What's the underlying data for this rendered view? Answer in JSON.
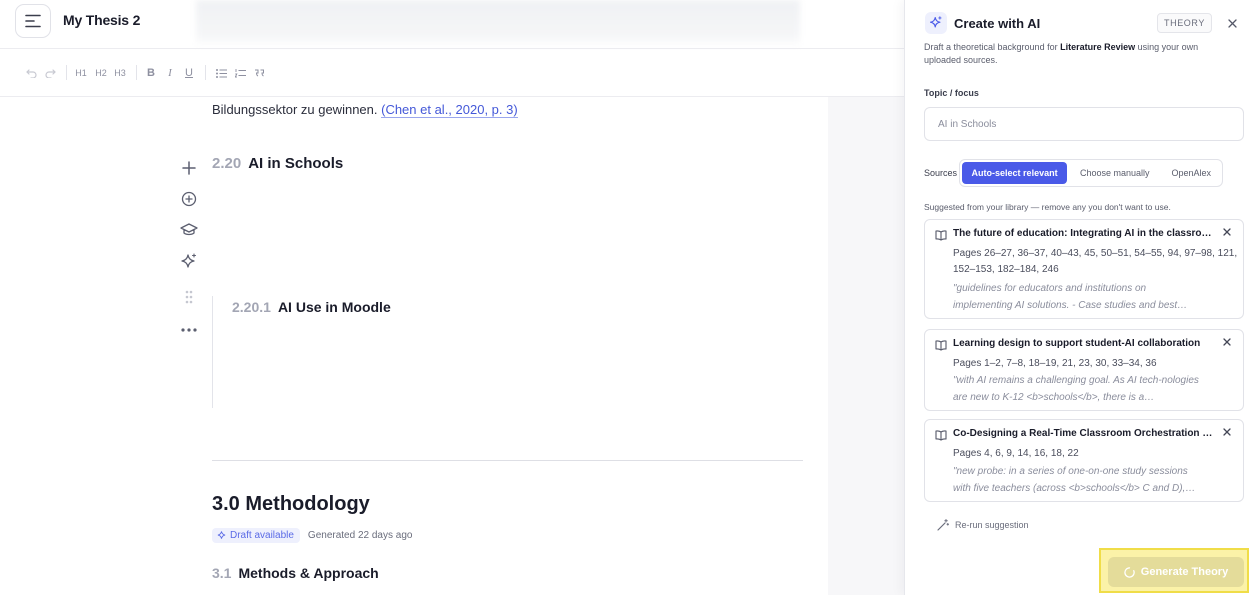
{
  "app": {
    "doc_title": "My Thesis 2"
  },
  "toolbar": {
    "h1": "H1",
    "h2": "H2",
    "h3": "H3",
    "bold": "B",
    "italic": "I",
    "underline": "U"
  },
  "document": {
    "paragraph_text": "Bildungssektor zu gewinnen. ",
    "paragraph_citation": "(Chen et al., 2020, p. 3)",
    "section_220": {
      "number": "2.20",
      "title": "AI in Schools"
    },
    "section_2201": {
      "number": "2.20.1",
      "title": "AI Use in Moodle"
    },
    "section_30": {
      "number": "3.0",
      "title": "Methodology"
    },
    "draft_badge": "Draft available",
    "generated_ago": "Generated 22 days ago",
    "section_31": {
      "number": "3.1",
      "title": "Methods & Approach"
    }
  },
  "panel": {
    "title": "Create with AI",
    "tag": "THEORY",
    "description_prefix": "Draft a theoretical background for ",
    "description_bold": "Literature Review",
    "description_suffix": " using your own uploaded sources.",
    "topic_label": "Topic / focus",
    "topic_value": "AI in Schools",
    "sources_label": "Sources",
    "source_options": [
      "Auto-select relevant",
      "Choose manually",
      "OpenAlex"
    ],
    "suggest_text": "Suggested from your library — remove any you don't want to use.",
    "cards": [
      {
        "title": "The future of education: Integrating AI in the classroom",
        "pages": "Pages 26–27, 36–37, 40–43, 45, 50–51, 54–55, 94, 97–98, 121, 152–153, 182–184, 246",
        "quote": "\"guidelines for educators and institutions on implementing AI solutions. - Case studies and best…"
      },
      {
        "title": "Learning design to support student-AI collaboration",
        "pages": "Pages 1–2, 7–8, 18–19, 21, 23, 30, 33–34, 36",
        "quote": "\"with AI remains a challenging goal. As AI tech-nologies are new to K-12 <b>schools</b>, there is a…"
      },
      {
        "title": "Co-Designing a Real-Time Classroom Orchestration Tool",
        "pages": "Pages 4, 6, 9, 14, 16, 18, 22",
        "quote": "\"new probe: in a series of one-on-one study sessions with five teachers (across <b>schools</b> C and D),…"
      }
    ],
    "rerun_label": "Re-run suggestion",
    "generate_label": "Generate Theory"
  },
  "colors": {
    "accent": "#4a5ae8",
    "citation": "#4458d8",
    "highlight_border": "#f0dd48",
    "highlight_fill": "#fbf2a8"
  },
  "icons": [
    "menu-icon",
    "undo-icon",
    "redo-icon",
    "bullet-list-icon",
    "numbered-list-icon",
    "quote-icon",
    "plus-icon",
    "circle-plus-icon",
    "graduation-cap-icon",
    "sparkle-icon",
    "drag-handle-icon",
    "more-icon",
    "book-icon",
    "close-icon",
    "wand-icon",
    "spinner-icon"
  ]
}
